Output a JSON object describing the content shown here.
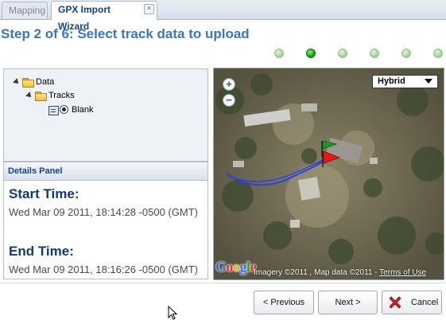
{
  "tabs": [
    {
      "label": "Mapping",
      "active": false
    },
    {
      "label": "GPX Import Wizard",
      "active": true,
      "close_glyph": "×"
    }
  ],
  "wizard": {
    "title": "Step 2 of 6: Select track data to upload",
    "total_steps": 6,
    "current_step": 2
  },
  "tree": {
    "root": "Data",
    "folder": "Tracks",
    "item": "Blank"
  },
  "details": {
    "header": "Details Panel",
    "start_label": "Start Time:",
    "start_value": "Wed Mar 09 2011, 18:14:28 -0500 (GMT)",
    "end_label": "End Time:",
    "end_value": "Wed Mar 09 2011, 18:16:26 -0500 (GMT)"
  },
  "map": {
    "zoom_in": "+",
    "zoom_out": "−",
    "map_type": "Hybrid",
    "logo": "Google",
    "attribution": "Imagery ©2011 , Map data ©2011 - ",
    "terms": "Terms of Use",
    "track_color": "#2a3fe0",
    "start_flag_color": "#1e9a1e",
    "end_flag_color": "#e01b1b"
  },
  "buttons": {
    "previous": "< Previous",
    "next": "Next >",
    "cancel": "Cancel"
  },
  "colors": {
    "accent": "#3a77c1",
    "step_active": "#1da41b",
    "step_inactive": "#a9d79b",
    "cancel_icon": "#d42020"
  }
}
